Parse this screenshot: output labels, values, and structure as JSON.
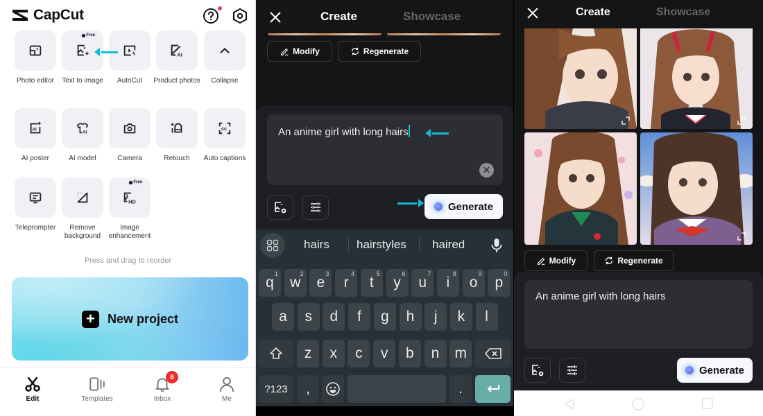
{
  "panel1": {
    "app_name": "CapCut",
    "header_icons": [
      "help-icon",
      "settings-icon"
    ],
    "tools": [
      {
        "label": "Photo editor",
        "icon": "photo-editor-icon"
      },
      {
        "label": "Text to image",
        "icon": "text-to-image-icon",
        "badge": "Free"
      },
      {
        "label": "AutoCut",
        "icon": "autocut-icon"
      },
      {
        "label": "Product photos",
        "icon": "product-photos-icon"
      },
      {
        "label": "Collapse",
        "icon": "chevron-up-icon"
      },
      {
        "label": "AI poster",
        "icon": "ai-poster-icon"
      },
      {
        "label": "AI model",
        "icon": "ai-model-icon"
      },
      {
        "label": "Camera",
        "icon": "camera-icon"
      },
      {
        "label": "Retouch",
        "icon": "retouch-icon"
      },
      {
        "label": "Auto captions",
        "icon": "auto-captions-icon"
      },
      {
        "label": "Teleprompter",
        "icon": "teleprompter-icon"
      },
      {
        "label": "Remove background",
        "icon": "remove-background-icon"
      },
      {
        "label": "Image enhancement",
        "icon": "image-enhancement-icon",
        "badge": "Free"
      }
    ],
    "hint": "Press and drag to reorder",
    "new_project_label": "New project",
    "tabbar": [
      {
        "label": "Edit",
        "icon": "scissors-icon",
        "active": true
      },
      {
        "label": "Templates",
        "icon": "templates-icon"
      },
      {
        "label": "Inbox",
        "icon": "bell-icon",
        "badge": "6"
      },
      {
        "label": "Me",
        "icon": "person-icon"
      }
    ]
  },
  "panel2": {
    "tabs": [
      "Create",
      "Showcase"
    ],
    "active_tab": "Create",
    "modify_label": "Modify",
    "regenerate_label": "Regenerate",
    "prompt_value": "An anime girl with long hairs",
    "generate_label": "Generate",
    "suggestions": [
      "hairs",
      "hairstyles",
      "haired"
    ],
    "keyboard": {
      "row1": [
        "q",
        "w",
        "e",
        "r",
        "t",
        "y",
        "u",
        "i",
        "o",
        "p"
      ],
      "row1_hints": [
        "1",
        "2",
        "3",
        "4",
        "5",
        "6",
        "7",
        "8",
        "9",
        "0"
      ],
      "row2": [
        "a",
        "s",
        "d",
        "f",
        "g",
        "h",
        "j",
        "k",
        "l"
      ],
      "row3": [
        "z",
        "x",
        "c",
        "v",
        "b",
        "n",
        "m"
      ],
      "symbols_label": "?123",
      "comma": ",",
      "period": "."
    }
  },
  "panel3": {
    "tabs": [
      "Create",
      "Showcase"
    ],
    "active_tab": "Create",
    "images": [
      "generated-image-1",
      "generated-image-2",
      "generated-image-3",
      "generated-image-4"
    ],
    "modify_label": "Modify",
    "regenerate_label": "Regenerate",
    "prompt_value": "An anime girl with long hairs",
    "generate_label": "Generate"
  },
  "colors": {
    "accent_arrow": "#12b9d6",
    "dark_bg": "#151517",
    "badge_red": "#f02c2c",
    "enter_key": "#67aea6"
  }
}
